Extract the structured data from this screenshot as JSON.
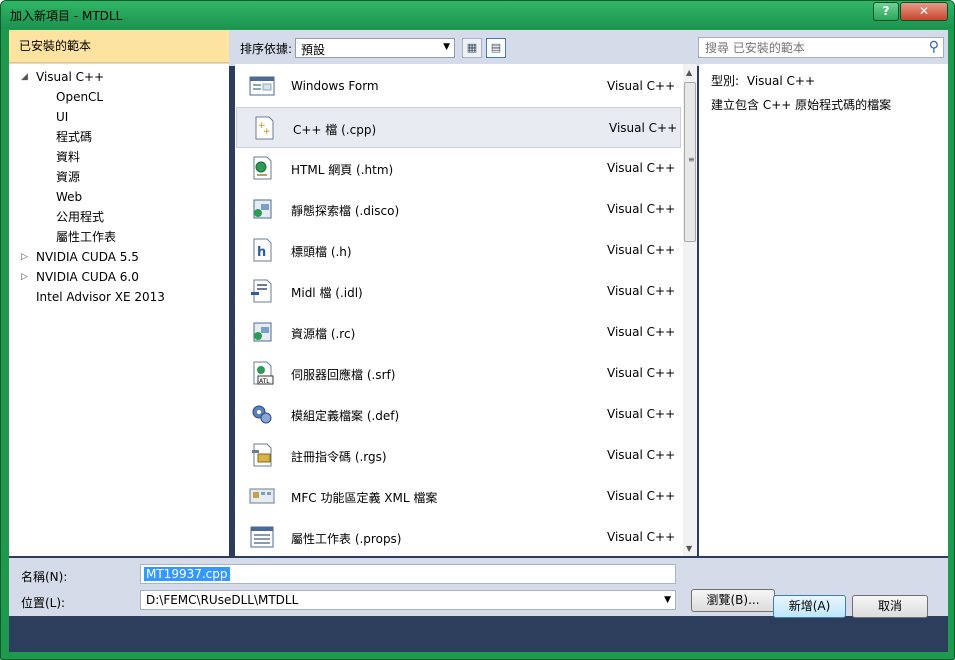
{
  "window": {
    "title": "加入新項目 - MTDLL",
    "help_label": "?",
    "close_label": "✕"
  },
  "left_panel": {
    "header": "已安裝的範本",
    "tree": [
      {
        "label": "Visual C++",
        "arrow": "◢",
        "indent": 0
      },
      {
        "label": "OpenCL",
        "arrow": "",
        "indent": 1
      },
      {
        "label": "UI",
        "arrow": "",
        "indent": 1
      },
      {
        "label": "程式碼",
        "arrow": "",
        "indent": 1
      },
      {
        "label": "資料",
        "arrow": "",
        "indent": 1
      },
      {
        "label": "資源",
        "arrow": "",
        "indent": 1
      },
      {
        "label": "Web",
        "arrow": "",
        "indent": 1
      },
      {
        "label": "公用程式",
        "arrow": "",
        "indent": 1
      },
      {
        "label": "屬性工作表",
        "arrow": "",
        "indent": 1
      },
      {
        "label": "NVIDIA CUDA 5.5",
        "arrow": "▷",
        "indent": 0
      },
      {
        "label": "NVIDIA CUDA 6.0",
        "arrow": "▷",
        "indent": 0
      },
      {
        "label": "Intel Advisor XE 2013",
        "arrow": "",
        "indent": 0
      }
    ]
  },
  "toolbar": {
    "sort_label": "排序依據:",
    "sort_value": "預設",
    "search_placeholder": "搜尋 已安裝的範本"
  },
  "templates": [
    {
      "name": "Windows Form",
      "lang": "Visual C++",
      "icon": "form-icon"
    },
    {
      "name": "C++ 檔 (.cpp)",
      "lang": "Visual C++",
      "icon": "cpp-file-icon",
      "selected": true
    },
    {
      "name": "HTML 網頁 (.htm)",
      "lang": "Visual C++",
      "icon": "html-page-icon"
    },
    {
      "name": "靜態探索檔 (.disco)",
      "lang": "Visual C++",
      "icon": "disco-file-icon"
    },
    {
      "name": "標頭檔 (.h)",
      "lang": "Visual C++",
      "icon": "header-file-icon"
    },
    {
      "name": "Midl 檔 (.idl)",
      "lang": "Visual C++",
      "icon": "idl-file-icon"
    },
    {
      "name": "資源檔 (.rc)",
      "lang": "Visual C++",
      "icon": "resource-file-icon"
    },
    {
      "name": "伺服器回應檔 (.srf)",
      "lang": "Visual C++",
      "icon": "srf-file-icon"
    },
    {
      "name": "模組定義檔案 (.def)",
      "lang": "Visual C++",
      "icon": "def-file-icon"
    },
    {
      "name": "註冊指令碼 (.rgs)",
      "lang": "Visual C++",
      "icon": "rgs-file-icon"
    },
    {
      "name": "MFC 功能區定義 XML 檔案",
      "lang": "Visual C++",
      "icon": "ribbon-xml-icon"
    },
    {
      "name": "屬性工作表 (.props)",
      "lang": "Visual C++",
      "icon": "props-file-icon"
    }
  ],
  "detail": {
    "type_label": "型別:",
    "type_value": "Visual C++",
    "description": "建立包含 C++ 原始程式碼的檔案"
  },
  "form": {
    "name_label": "名稱(N):",
    "name_value": "MT19937.cpp",
    "location_label": "位置(L):",
    "location_value": "D:\\FEMC\\RUseDLL\\MTDLL",
    "browse_label": "瀏覽(B)..."
  },
  "buttons": {
    "ok": "新增(A)",
    "cancel": "取消"
  }
}
